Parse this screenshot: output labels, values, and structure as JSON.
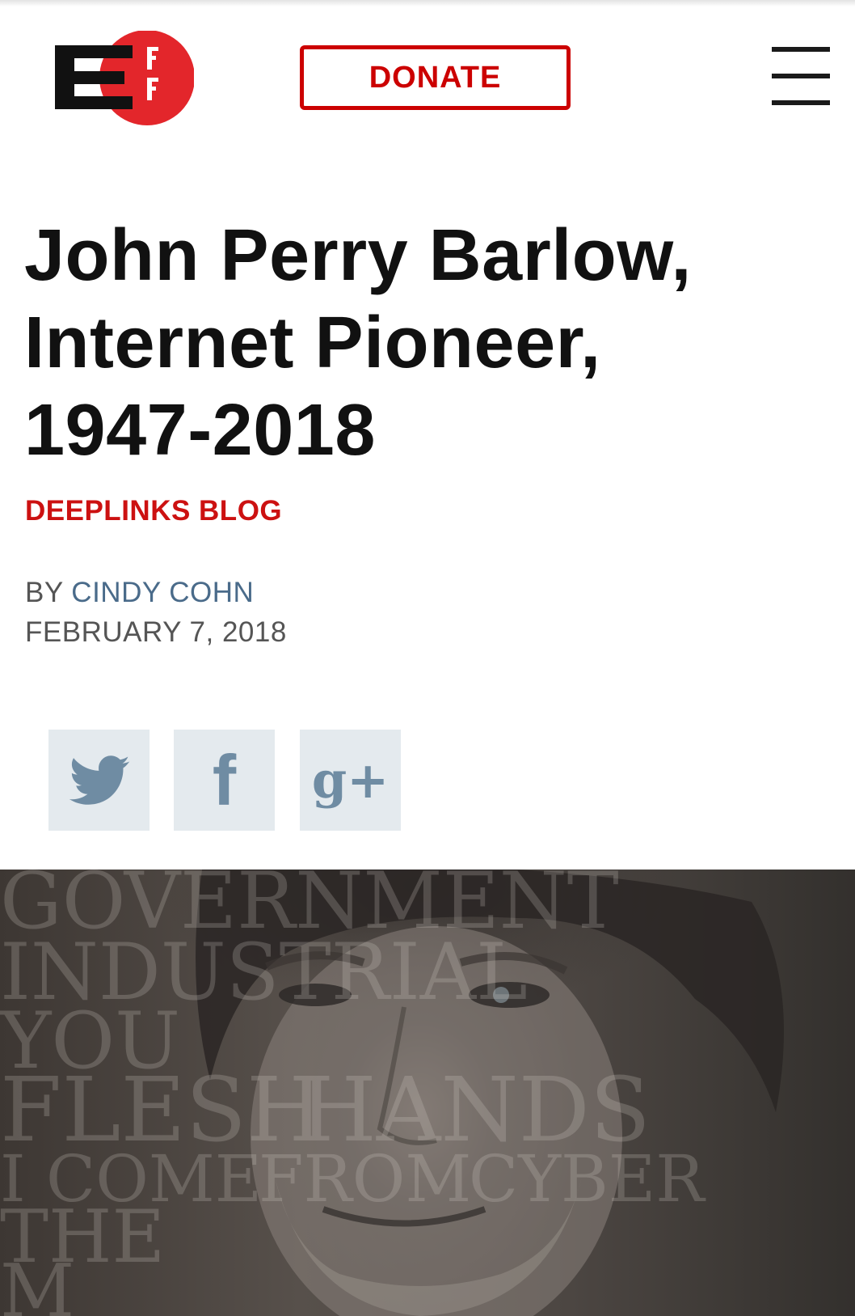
{
  "header": {
    "logo_letters": "EFF",
    "logo_colors": {
      "dark": "#111111",
      "red": "#e3262b"
    },
    "donate_label": "DONATE",
    "menu_icon": "hamburger-menu-icon"
  },
  "article": {
    "title_lines": [
      "John Perry Barlow,",
      "Internet Pioneer,",
      "1947-2018"
    ],
    "category": "DEEPLINKS BLOG",
    "by_prefix": "BY",
    "author": "CINDY COHN",
    "date": "FEBRUARY 7, 2018"
  },
  "share": {
    "twitter_icon": "twitter-icon",
    "facebook_icon": "facebook-icon",
    "facebook_glyph": "f",
    "gplus_icon": "google-plus-icon",
    "gplus_glyph": "g+"
  },
  "hero": {
    "overlay_words": [
      "GOVERNMENT",
      "INDUSTRIAL",
      "YOU",
      "FLESH",
      "HANDS",
      "I COME",
      "FROM",
      "CYBER",
      "THE",
      "M"
    ]
  },
  "colors": {
    "accent_red": "#cc0000",
    "author_blue": "#4a6b8a",
    "share_bg": "#e4eaee",
    "share_icon": "#6f8ca3"
  }
}
